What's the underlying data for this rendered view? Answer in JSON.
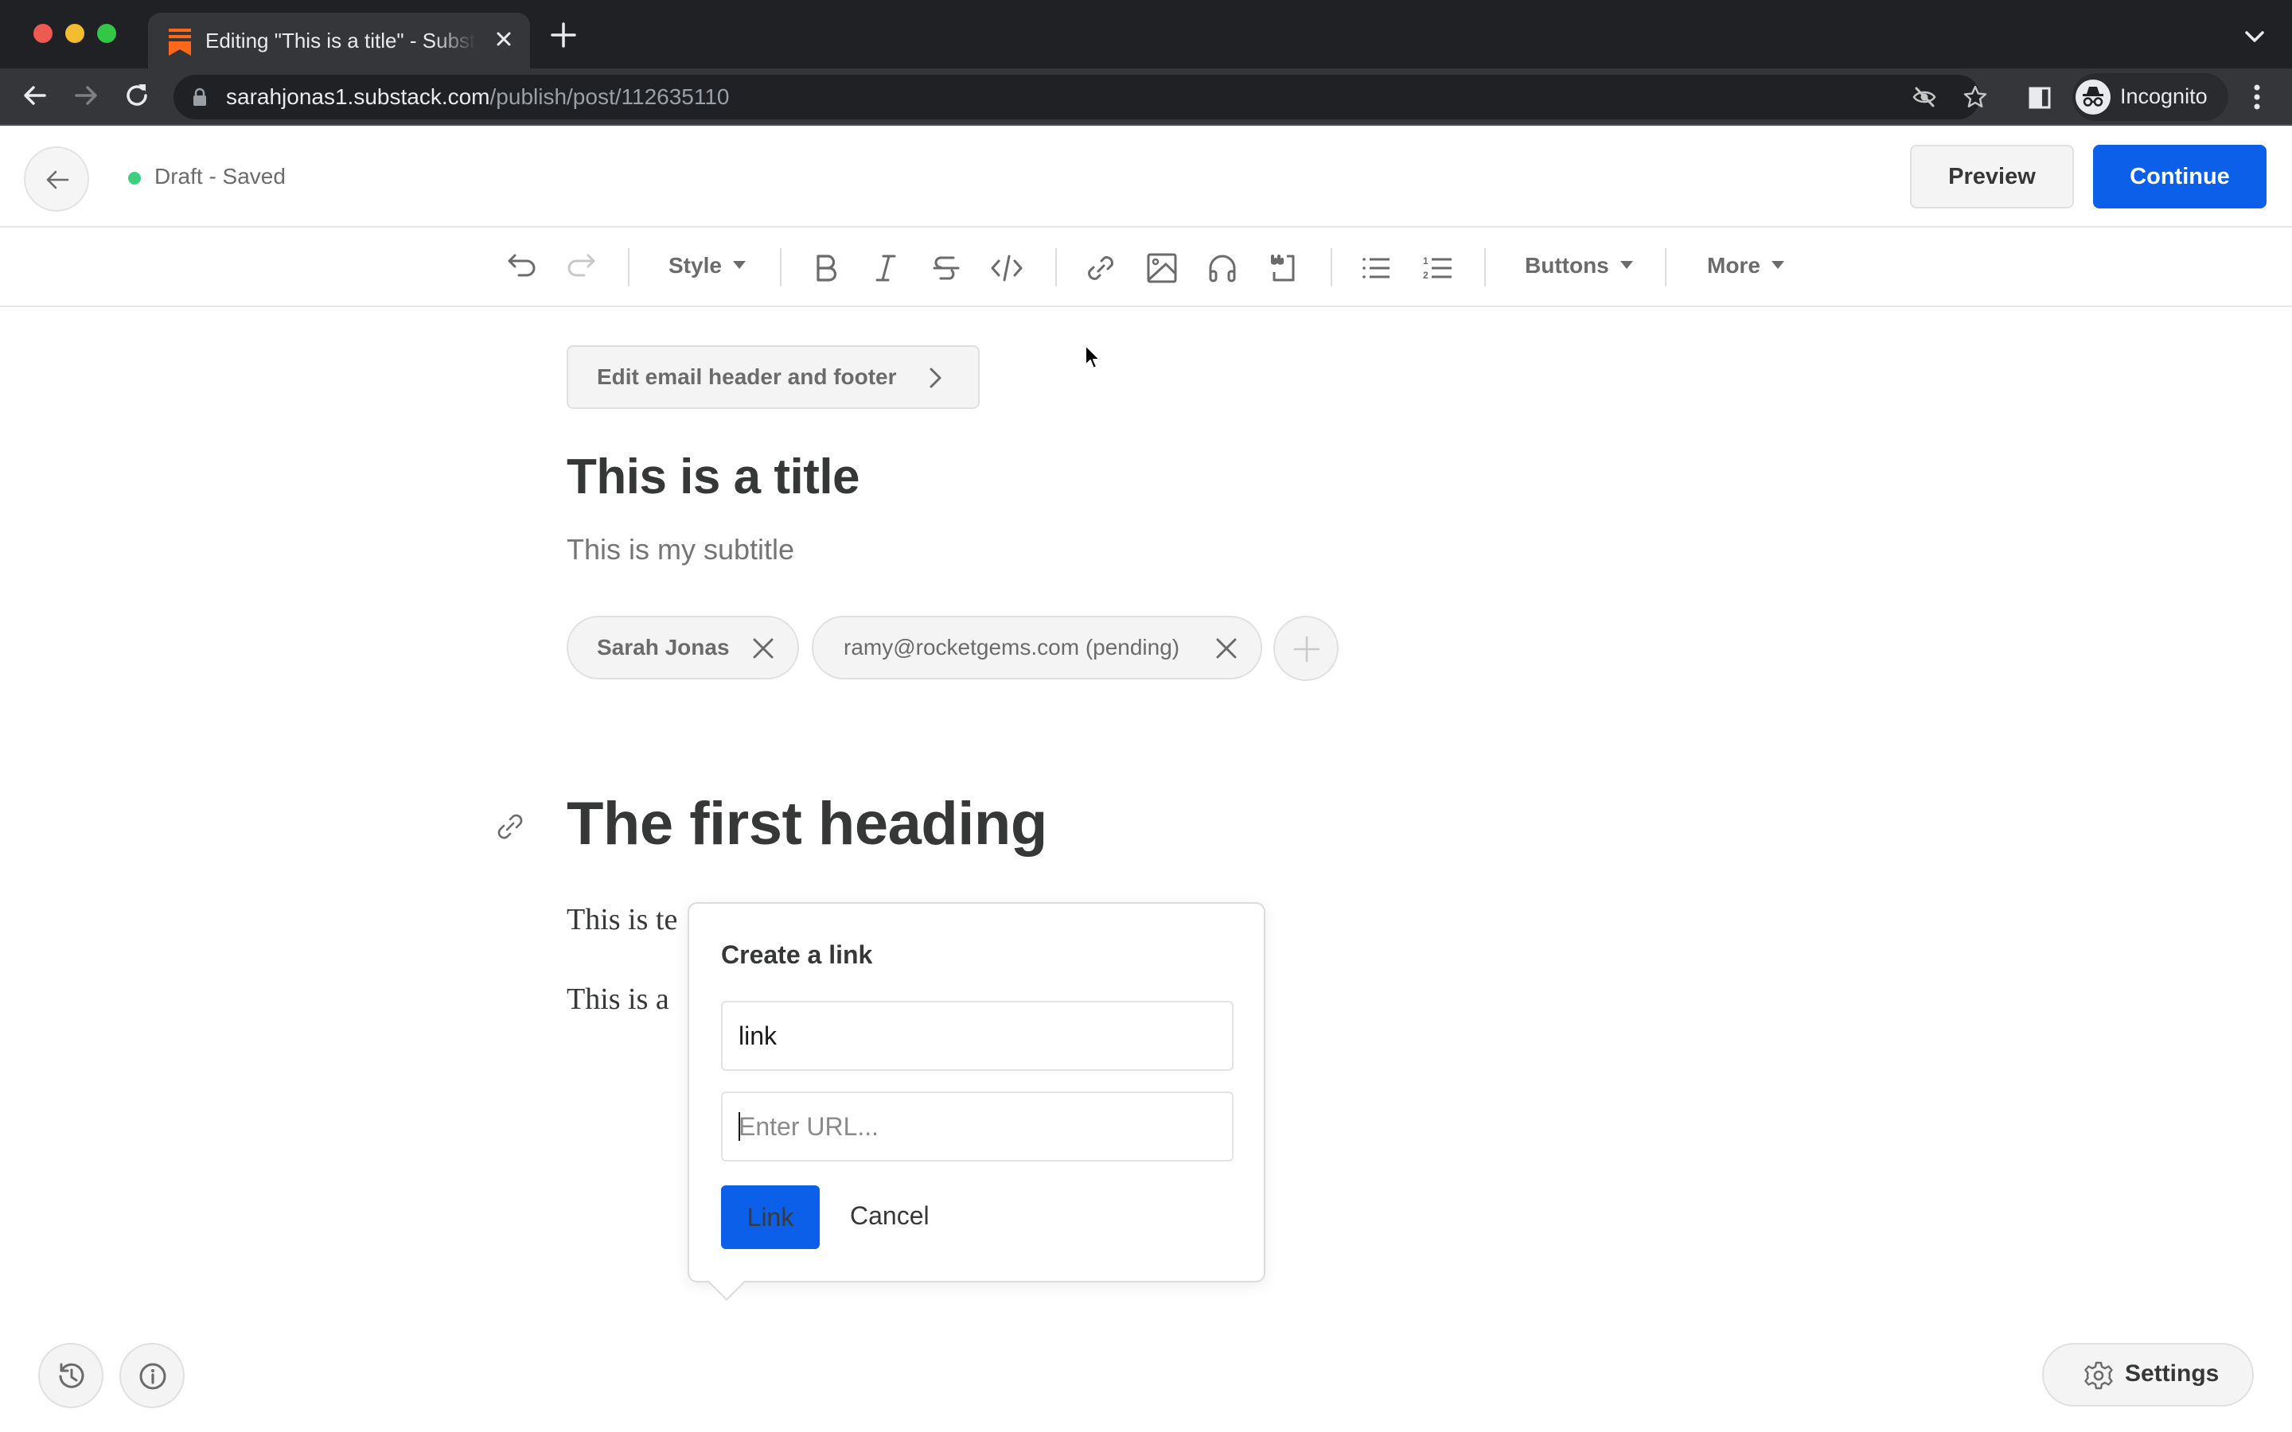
{
  "browser": {
    "tab": {
      "title": "Editing \"This is a title\" - Substack",
      "favicon": "substack-logo-icon",
      "close_icon": "close-icon"
    },
    "new_tab_icon": "plus-icon",
    "tab_search_icon": "chevron-down-icon",
    "nav": {
      "back_icon": "arrow-left-icon",
      "forward_icon": "arrow-right-icon",
      "reload_icon": "reload-icon"
    },
    "address": {
      "host": "sarahjonas1.substack.com",
      "path": "/publish/post/112635110",
      "lock_icon": "lock-icon"
    },
    "omnibox_icons": [
      "eye-off-icon",
      "star-icon"
    ],
    "side_panel_icon": "side-panel-icon",
    "profile": {
      "label": "Incognito",
      "icon": "incognito-icon"
    },
    "menu_icon": "kebab-menu-icon",
    "colors": {
      "chrome_dark": "#202124",
      "tab_active": "#35363a"
    }
  },
  "header": {
    "back_icon": "arrow-left-icon",
    "status": {
      "text": "Draft - Saved",
      "dot_color": "#3dce7f"
    },
    "preview_label": "Preview",
    "continue_label": "Continue",
    "accent_color": "#0b5fe8"
  },
  "toolbar": {
    "undo_icon": "undo-icon",
    "redo_icon": "redo-icon",
    "style_label": "Style",
    "bold_icon": "bold-icon",
    "italic_icon": "italic-icon",
    "strike_icon": "strikethrough-icon",
    "code_icon": "code-icon",
    "link_icon": "link-icon",
    "image_icon": "image-icon",
    "audio_icon": "headphones-icon",
    "quote_icon": "pullquote-icon",
    "bullet_icon": "bulleted-list-icon",
    "numbered_icon": "numbered-list-icon",
    "buttons_label": "Buttons",
    "more_label": "More"
  },
  "editor": {
    "email_header_footer_label": "Edit email header and footer",
    "title": "This is a title",
    "subtitle": "This is my subtitle",
    "bylines": [
      {
        "label": "Sarah Jonas"
      },
      {
        "label": "ramy@rocketgems.com (pending)"
      }
    ],
    "heading": "The first heading",
    "paragraphs": [
      "This is te",
      "This is a"
    ]
  },
  "link_popover": {
    "title": "Create a link",
    "text_value": "link",
    "url_value": "",
    "url_placeholder": "Enter URL...",
    "link_label": "Link",
    "cancel_label": "Cancel"
  },
  "footer": {
    "history_icon": "history-icon",
    "info_icon": "info-icon",
    "settings_label": "Settings",
    "settings_icon": "gear-icon"
  }
}
